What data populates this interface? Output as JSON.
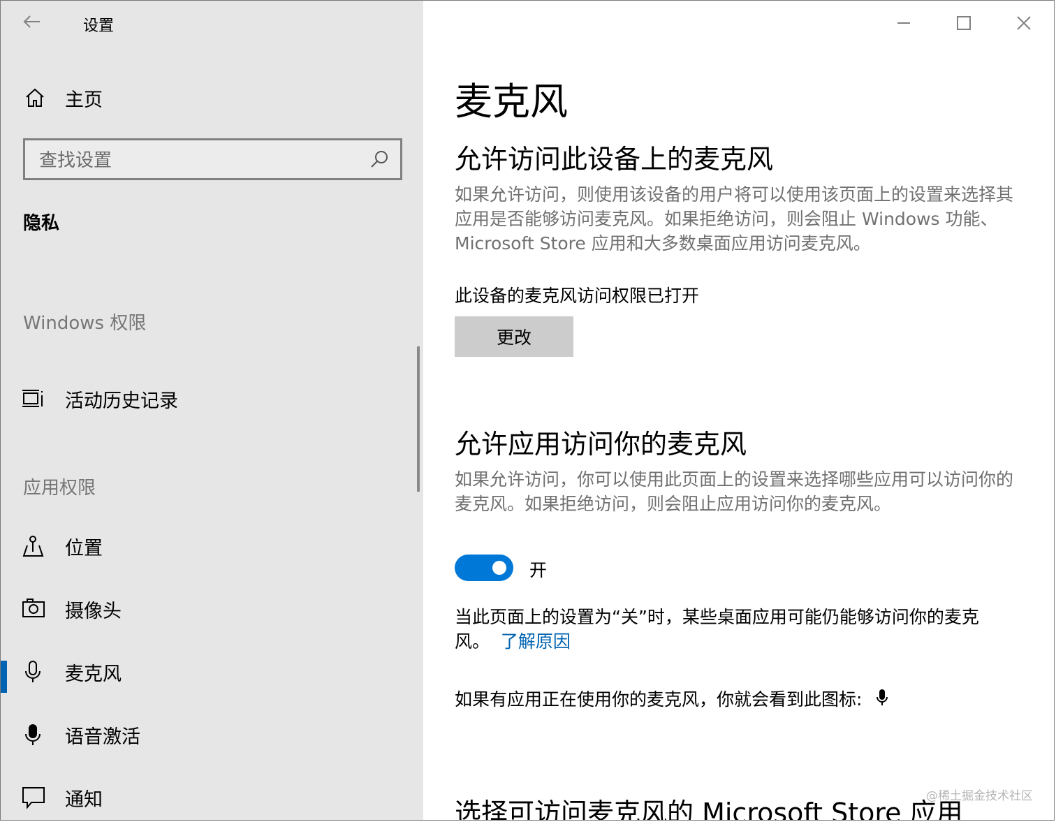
{
  "window": {
    "title": "设置"
  },
  "sidebar": {
    "home_label": "主页",
    "search_placeholder": "查找设置",
    "section_title": "隐私",
    "groups": [
      {
        "heading": "Windows 权限",
        "items": [
          {
            "label": "活动历史记录",
            "icon": "activity-history-icon"
          }
        ]
      },
      {
        "heading": "应用权限",
        "items": [
          {
            "label": "位置",
            "icon": "location-icon"
          },
          {
            "label": "摄像头",
            "icon": "camera-icon"
          },
          {
            "label": "麦克风",
            "icon": "microphone-icon",
            "active": true
          },
          {
            "label": "语音激活",
            "icon": "voice-activation-icon"
          },
          {
            "label": "通知",
            "icon": "notification-icon"
          }
        ]
      }
    ]
  },
  "main": {
    "page_title": "麦克风",
    "device_section": {
      "heading": "允许访问此设备上的麦克风",
      "description": "如果允许访问，则使用该设备的用户将可以使用该页面上的设置来选择其应用是否能够访问麦克风。如果拒绝访问，则会阻止 Windows 功能、Microsoft Store 应用和大多数桌面应用访问麦克风。",
      "status": "此设备的麦克风访问权限已打开",
      "change_button": "更改"
    },
    "apps_section": {
      "heading": "允许应用访问你的麦克风",
      "description": "如果允许访问，你可以使用此页面上的设置来选择哪些应用可以访问你的麦克风。如果拒绝访问，则会阻止应用访问你的麦克风。",
      "toggle_state": "开",
      "toggle_on": true,
      "note": "当此页面上的设置为“关”时，某些桌面应用可能仍能够访问你的麦克风。",
      "learn_more": "了解原因",
      "icon_hint": "如果有应用正在使用你的麦克风，你就会看到此图标:"
    },
    "store_section": {
      "heading": "选择可访问麦克风的 Microsoft Store 应用"
    },
    "watermark": "@稀土掘金技术社区"
  },
  "colors": {
    "accent": "#0078d7",
    "link": "#0063b1",
    "sidebar_bg": "#e6e6e6"
  }
}
